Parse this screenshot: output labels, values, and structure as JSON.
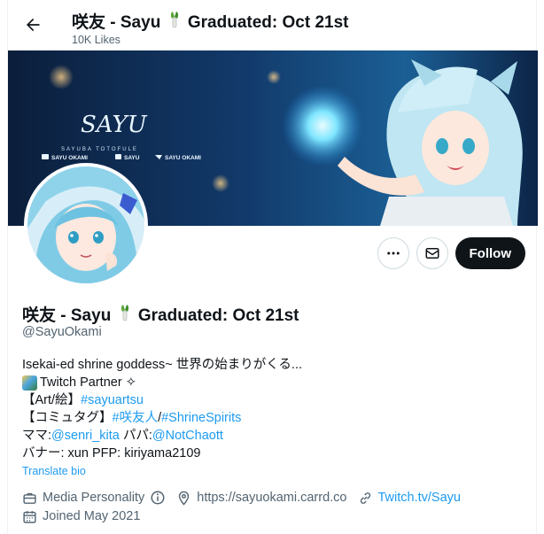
{
  "header": {
    "display_name": "咲友 - Sayu",
    "name_suffix": "Graduated: Oct 21st",
    "likes": "10K Likes"
  },
  "banner": {
    "title": "SAYU",
    "subtitle": "SAYUBA TOTOFULE",
    "socials": [
      "SAYU OKAMI",
      "SAYU",
      "SAYU OKAMI"
    ]
  },
  "actions": {
    "follow_label": "Follow"
  },
  "profile": {
    "display_name": "咲友 - Sayu",
    "name_suffix": "Graduated: Oct 21st",
    "handle": "@SayuOkami"
  },
  "bio": {
    "line1": "Isekai-ed shrine goddess~ 世界の始まりがくる...",
    "line2": "Twitch Partner ✧",
    "line3_prefix": "【Art/絵】",
    "line3_link": "#sayuartsu",
    "line4_prefix": "【コミュタグ】",
    "line4_link1": "#咲友人",
    "line4_sep": "/",
    "line4_link2": "#ShrineSpirits",
    "line5_prefix": "ママ:",
    "line5_link1": "@senri_kita",
    "line5_mid": " パパ:",
    "line5_link2": "@NotChaott",
    "line6": "バナー: xun PFP: kiriyama2109",
    "translate": "Translate bio"
  },
  "meta": {
    "category": "Media Personality",
    "website": "https://sayuokami.carrd.co",
    "link": "Twitch.tv/Sayu",
    "joined": "Joined May 2021"
  },
  "colors": {
    "accent": "#1d9bf0",
    "text": "#0f1419",
    "muted": "#536471"
  }
}
